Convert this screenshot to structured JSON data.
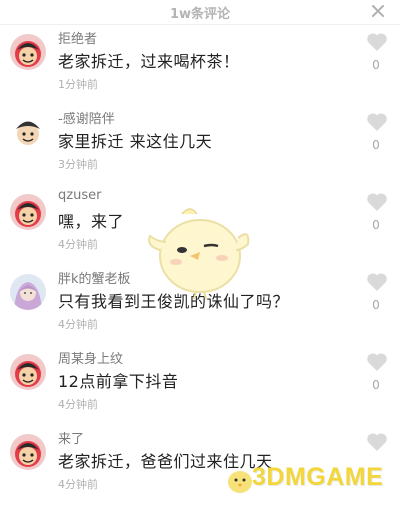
{
  "header": {
    "title": "1w条评论",
    "close_icon": "close-icon"
  },
  "comments": [
    {
      "username": "拒绝者",
      "content": "老家拆迁，过来喝杯茶！",
      "time": "1分钟前",
      "likes": "0",
      "avatar": "red-cartoon-face"
    },
    {
      "username": "-感谢陪伴",
      "content": "家里拆迁 来这住几天",
      "time": "3分钟前",
      "likes": "0",
      "avatar": "white-cartoon-face"
    },
    {
      "username": "qzuser",
      "content": "嘿，来了",
      "time": "4分钟前",
      "likes": "0",
      "avatar": "red-cartoon-face"
    },
    {
      "username": "胖k的蟹老板",
      "content": "只有我看到王俊凯的诛仙了吗？",
      "time": "4分钟前",
      "likes": "0",
      "avatar": "photo-girl"
    },
    {
      "username": "周某身上纹",
      "content": "12点前拿下抖音",
      "time": "4分钟前",
      "likes": "0",
      "avatar": "red-cartoon-face"
    },
    {
      "username": "来了",
      "content": "老家拆迁，爸爸们过来住几天",
      "time": "4分钟前",
      "likes": "",
      "avatar": "red-cartoon-face"
    }
  ],
  "watermark": {
    "text": "3DMGAME"
  },
  "colors": {
    "watermark": "#f2d63a",
    "heart": "#d9d9d9",
    "username": "#7a7a7a"
  }
}
